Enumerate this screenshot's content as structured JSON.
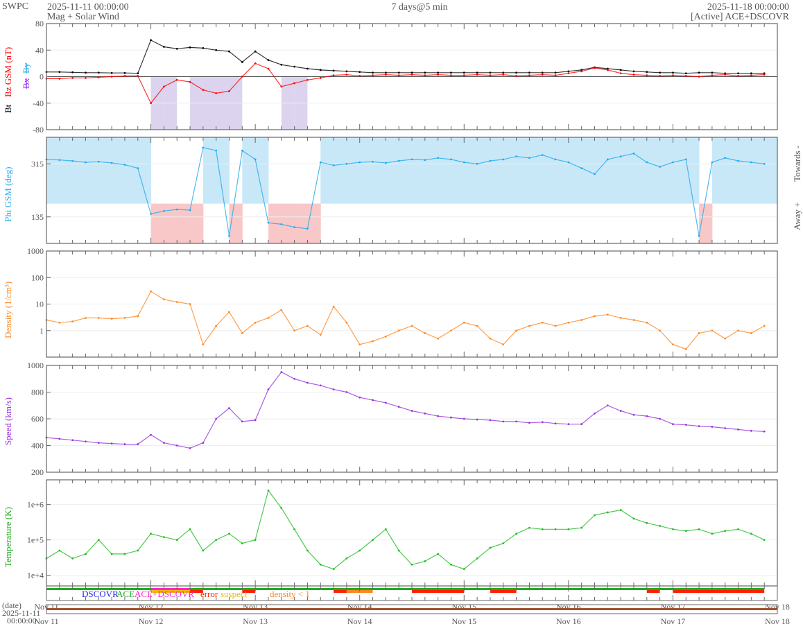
{
  "header": {
    "org": "SWPC",
    "start_time": "2025-11-11 00:00:00",
    "product": "Mag + Solar Wind",
    "span": "7 days@5 min",
    "end_time": "2025-11-18 00:00:00",
    "source": "[Active] ACE+DSCOVR"
  },
  "axis_labels": {
    "bt": "Bt",
    "bz": "Bz GSM (nT)",
    "bx": "Bx",
    "by": "By",
    "phi": "Phi GSM (deg)",
    "towards": "Towards -",
    "away": "Away +",
    "density": "Density (1/cm³)",
    "speed": "Speed (km/s)",
    "temperature": "Temperature (K)",
    "date_label": "(date)",
    "date_start_day": "2025-11-11",
    "date_start_time": "00:00:00"
  },
  "legend": {
    "dscovr": "DSCOVR",
    "ace": "ACE",
    "ace_dscovr": "ACE+DSCOVR",
    "error": "error",
    "suspect": "suspect",
    "density_low": "density < 1"
  },
  "colors": {
    "bt": "#000000",
    "bz": "#ff0000",
    "bx": "#9933ff",
    "by": "#22aaee",
    "phi": "#22aaee",
    "towards_fill": "#c8e8f8",
    "away_fill": "#f8c8c8",
    "south_fill": "#dcd4ee",
    "density": "#ff8822",
    "speed": "#9933dd",
    "temperature": "#22bb22",
    "ace": "#22aa22",
    "dscovr": "#2222ee",
    "ace_dscovr": "#ff22cc",
    "error": "#ff2200",
    "suspect": "#eebb00",
    "density_low": "#ff8822"
  },
  "chart_data": {
    "type": "line",
    "x_tick_labels": [
      "Nov 11",
      "Nov 12",
      "Nov 13",
      "Nov 14",
      "Nov 15",
      "Nov 16",
      "Nov 17",
      "Nov 18"
    ],
    "x_hours": [
      0,
      3,
      6,
      9,
      12,
      15,
      18,
      21,
      24,
      27,
      30,
      33,
      36,
      39,
      42,
      45,
      48,
      51,
      54,
      57,
      60,
      63,
      66,
      69,
      72,
      75,
      78,
      81,
      84,
      87,
      90,
      93,
      96,
      99,
      102,
      105,
      108,
      111,
      114,
      117,
      120,
      123,
      126,
      129,
      132,
      135,
      138,
      141,
      144,
      147,
      150,
      153,
      156,
      159,
      162,
      165
    ],
    "xlim_hours": [
      0,
      168
    ],
    "panels": [
      {
        "name": "mag",
        "ylabel": "Bt / Bz GSM (nT)",
        "ylim": [
          -80,
          80
        ],
        "scale": "linear",
        "y_ticks": [
          80,
          40,
          0,
          -40,
          -80
        ],
        "y_tick_labels": [
          "80",
          "40",
          "0",
          "-40",
          "-80"
        ],
        "series": [
          {
            "name": "Bt",
            "values": [
              7,
              7,
              6.5,
              6,
              6,
              5.5,
              5.5,
              5,
              55,
              45,
              42,
              44,
              43,
              40,
              38,
              22,
              38,
              25,
              18,
              15,
              12,
              10,
              9,
              8,
              7,
              6,
              6,
              6,
              6,
              6,
              6,
              6,
              6,
              6,
              6,
              6,
              6,
              6,
              6,
              6,
              8,
              10,
              14,
              12,
              10,
              8,
              7,
              6,
              6,
              5,
              6,
              6,
              5,
              5,
              5,
              5
            ]
          },
          {
            "name": "Bz",
            "values": [
              -3,
              -3,
              -2,
              -2,
              -1,
              0,
              1,
              1,
              -40,
              -15,
              -5,
              -8,
              -20,
              -25,
              -22,
              0,
              20,
              12,
              -15,
              -10,
              -5,
              -2,
              2,
              3,
              1,
              2,
              3,
              2,
              3,
              2,
              3,
              2,
              2,
              3,
              2,
              3,
              1,
              2,
              3,
              2,
              5,
              8,
              13,
              10,
              5,
              3,
              2,
              1,
              2,
              1,
              0,
              2,
              3,
              1,
              2,
              3
            ]
          }
        ]
      },
      {
        "name": "phi",
        "ylabel": "Phi GSM (deg)",
        "ylim": [
          45,
          405
        ],
        "scale": "linear",
        "y_ticks": [
          315,
          135
        ],
        "y_tick_labels": [
          "315",
          "135"
        ],
        "series": [
          {
            "name": "Phi",
            "values": [
              330,
              328,
              325,
              320,
              322,
              318,
              312,
              300,
              145,
              155,
              160,
              158,
              370,
              360,
              70,
              360,
              330,
              115,
              110,
              100,
              95,
              320,
              310,
              315,
              320,
              322,
              318,
              325,
              330,
              328,
              335,
              330,
              320,
              315,
              325,
              330,
              340,
              335,
              345,
              330,
              320,
              300,
              280,
              330,
              340,
              350,
              320,
              305,
              320,
              330,
              70,
              320,
              335,
              325,
              320,
              315
            ]
          }
        ]
      },
      {
        "name": "density",
        "ylabel": "Density (1/cm³)",
        "ylim": [
          0.1,
          1000
        ],
        "scale": "log",
        "y_ticks": [
          1000,
          100,
          10,
          1
        ],
        "y_tick_labels": [
          "1000",
          "100",
          "10",
          "1"
        ],
        "series": [
          {
            "name": "Density",
            "values": [
              2.5,
              2,
              2.2,
              3,
              3,
              2.8,
              3,
              3.5,
              30,
              15,
              12,
              10,
              0.3,
              1.5,
              5,
              0.8,
              2,
              3,
              6,
              1,
              1.5,
              0.7,
              8,
              2,
              0.3,
              0.4,
              0.6,
              1,
              1.5,
              0.8,
              0.5,
              1,
              2,
              1.5,
              0.5,
              0.3,
              1,
              1.5,
              2,
              1.5,
              2,
              2.5,
              3.5,
              4,
              3,
              2.5,
              2,
              1,
              0.3,
              0.2,
              0.8,
              1,
              0.5,
              1,
              0.8,
              1.5
            ]
          }
        ]
      },
      {
        "name": "speed",
        "ylabel": "Speed (km/s)",
        "ylim": [
          200,
          1000
        ],
        "scale": "linear",
        "y_ticks": [
          1000,
          800,
          600,
          400,
          200
        ],
        "y_tick_labels": [
          "1000",
          "800",
          "600",
          "400",
          "200"
        ],
        "series": [
          {
            "name": "Speed",
            "values": [
              460,
              450,
              440,
              430,
              420,
              415,
              410,
              410,
              480,
              420,
              400,
              380,
              420,
              600,
              680,
              580,
              590,
              820,
              950,
              900,
              870,
              850,
              820,
              800,
              760,
              740,
              720,
              690,
              660,
              640,
              620,
              610,
              600,
              595,
              590,
              580,
              580,
              570,
              575,
              565,
              560,
              560,
              640,
              700,
              660,
              630,
              620,
              600,
              560,
              555,
              545,
              540,
              530,
              520,
              510,
              505
            ]
          }
        ]
      },
      {
        "name": "temperature",
        "ylabel": "Temperature (K)",
        "ylim": [
          5000,
          5000000
        ],
        "scale": "log",
        "y_ticks": [
          1000000,
          100000,
          10000
        ],
        "y_tick_labels": [
          "1e+6",
          "1e+5",
          "1e+4"
        ],
        "series": [
          {
            "name": "Temperature",
            "values": [
              30000,
              50000,
              30000,
              40000,
              100000,
              40000,
              40000,
              50000,
              150000,
              120000,
              100000,
              200000,
              50000,
              100000,
              150000,
              80000,
              100000,
              2500000,
              800000,
              200000,
              50000,
              20000,
              15000,
              30000,
              50000,
              100000,
              200000,
              50000,
              20000,
              25000,
              40000,
              20000,
              15000,
              30000,
              60000,
              80000,
              150000,
              220000,
              200000,
              200000,
              200000,
              220000,
              500000,
              600000,
              700000,
              400000,
              300000,
              250000,
              200000,
              180000,
              200000,
              150000,
              180000,
              200000,
              150000,
              100000
            ]
          }
        ]
      }
    ],
    "status_segments": [
      {
        "kind": "ace_dscovr",
        "from_hours": 24,
        "to_hours": 33
      },
      {
        "kind": "suspect",
        "from_hours": 24,
        "to_hours": 33
      },
      {
        "kind": "error",
        "from_hours": 33,
        "to_hours": 36
      },
      {
        "kind": "error",
        "from_hours": 45,
        "to_hours": 48
      },
      {
        "kind": "error",
        "from_hours": 66,
        "to_hours": 69
      },
      {
        "kind": "density_low",
        "from_hours": 69,
        "to_hours": 75
      },
      {
        "kind": "error",
        "from_hours": 84,
        "to_hours": 96
      },
      {
        "kind": "error",
        "from_hours": 102,
        "to_hours": 108
      },
      {
        "kind": "error",
        "from_hours": 138,
        "to_hours": 141
      },
      {
        "kind": "error",
        "from_hours": 144,
        "to_hours": 165
      }
    ]
  }
}
